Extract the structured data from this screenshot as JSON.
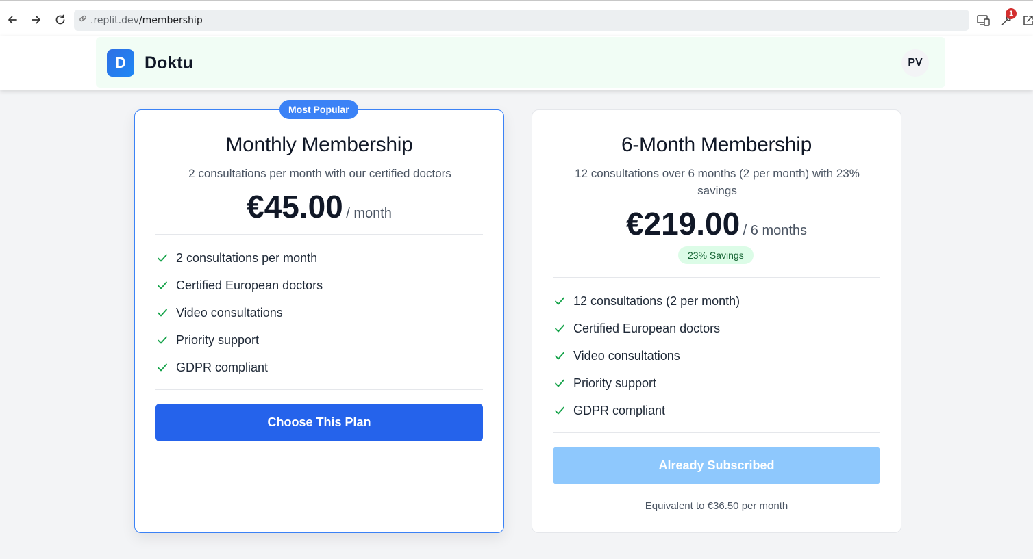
{
  "browser": {
    "url_domain": ".replit.dev",
    "url_path": "/membership",
    "notification_count": "1"
  },
  "header": {
    "logo_letter": "D",
    "brand": "Doktu",
    "avatar_initials": "PV"
  },
  "plans": [
    {
      "badge": "Most Popular",
      "title": "Monthly Membership",
      "description": "2 consultations per month with our certified doctors",
      "price": "€45.00",
      "period": "/ month",
      "features": [
        "2 consultations per month",
        "Certified European doctors",
        "Video consultations",
        "Priority support",
        "GDPR compliant"
      ],
      "button_label": "Choose This Plan"
    },
    {
      "title": "6-Month Membership",
      "description": "12 consultations over 6 months (2 per month) with 23% savings",
      "price": "€219.00",
      "period": "/ 6 months",
      "savings": "23% Savings",
      "features": [
        "12 consultations (2 per month)",
        "Certified European doctors",
        "Video consultations",
        "Priority support",
        "GDPR compliant"
      ],
      "button_label": "Already Subscribed",
      "equivalent": "Equivalent to €36.50 per month"
    }
  ],
  "colors": {
    "primary": "#2563eb",
    "accent_blue": "#3b82f6",
    "disabled_button": "#8ec8fd",
    "check_green": "#16a34a",
    "savings_bg": "#dcfce7"
  }
}
